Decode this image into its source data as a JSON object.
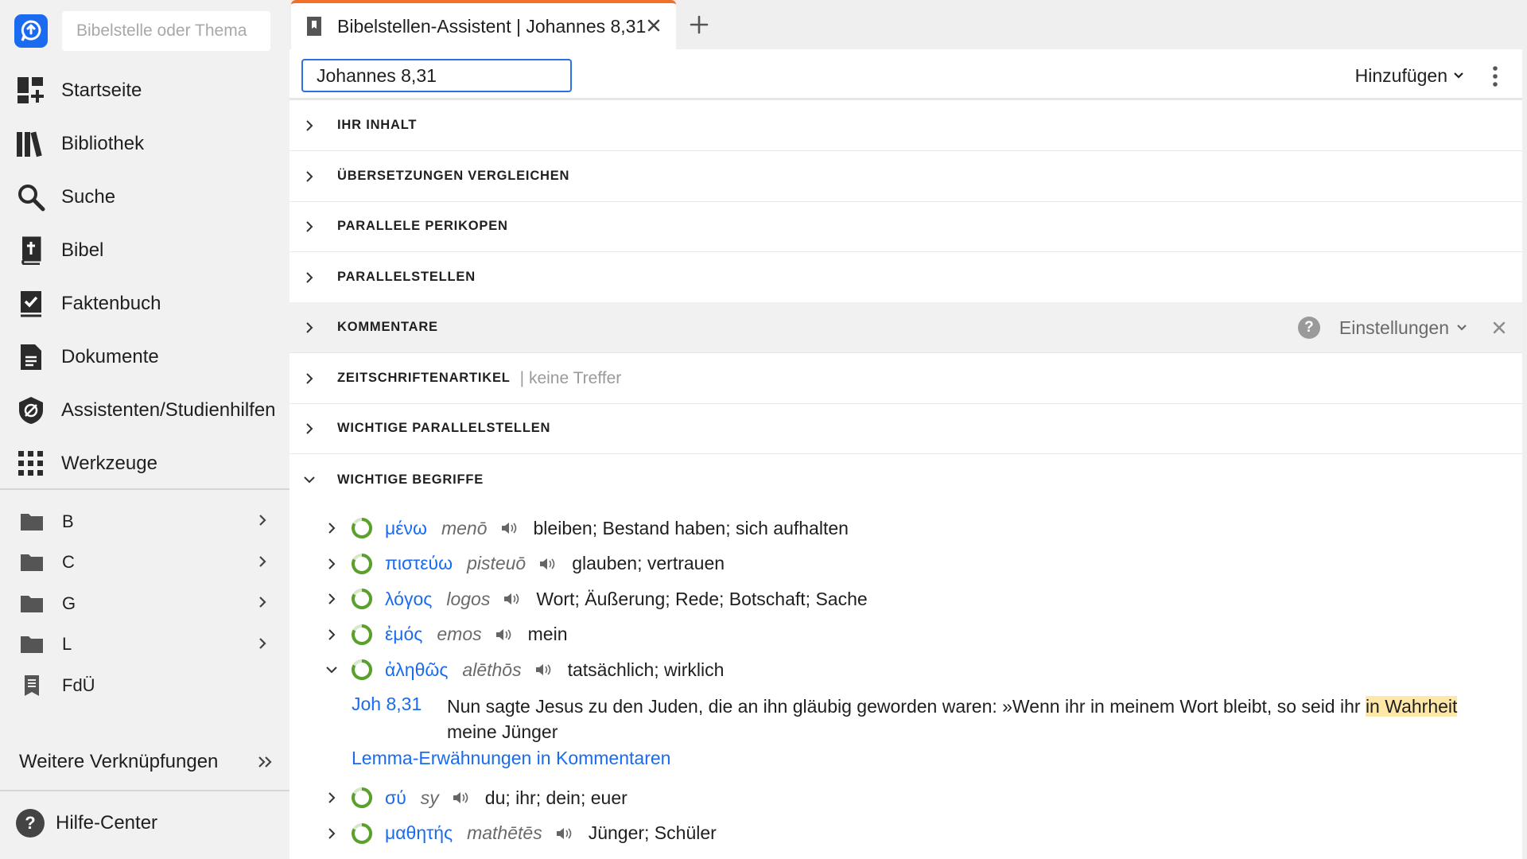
{
  "sidebar": {
    "search_placeholder": "Bibelstelle oder Thema",
    "nav": [
      {
        "label": "Startseite",
        "icon": "dashboard-icon"
      },
      {
        "label": "Bibliothek",
        "icon": "library-icon"
      },
      {
        "label": "Suche",
        "icon": "search-icon"
      },
      {
        "label": "Bibel",
        "icon": "bible-icon"
      },
      {
        "label": "Faktenbuch",
        "icon": "factbook-icon"
      },
      {
        "label": "Dokumente",
        "icon": "document-icon"
      },
      {
        "label": "Assistenten/Studienhilfen",
        "icon": "guide-icon"
      },
      {
        "label": "Werkzeuge",
        "icon": "apps-grid-icon"
      }
    ],
    "folders": [
      {
        "label": "B",
        "icon": "folder-icon"
      },
      {
        "label": "C",
        "icon": "folder-icon"
      },
      {
        "label": "G",
        "icon": "folder-icon"
      },
      {
        "label": "L",
        "icon": "folder-icon"
      },
      {
        "label": "FdÜ",
        "icon": "notebook-icon"
      }
    ],
    "more_links": "Weitere Verknüpfungen",
    "help": "Hilfe-Center"
  },
  "tab": {
    "title": "Bibelstellen-Assistent | Johannes 8,31",
    "accent": "#f0702a"
  },
  "toolbar": {
    "reference_value": "Johannes 8,31",
    "add_label": "Hinzufügen"
  },
  "sections": [
    {
      "title": "IHR INHALT"
    },
    {
      "title": "ÜBERSETZUNGEN VERGLEICHEN"
    },
    {
      "title": "PARALLELE PERIKOPEN"
    },
    {
      "title": "PARALLELSTELLEN"
    },
    {
      "title": "KOMMENTARE",
      "settings_label": "Einstellungen",
      "help_glyph": "?"
    },
    {
      "title": "ZEITSCHRIFTENARTIKEL",
      "note": "| keine Treffer"
    },
    {
      "title": "WICHTIGE PARALLELSTELLEN"
    },
    {
      "title": "WICHTIGE BEGRIFFE"
    }
  ],
  "terms": [
    {
      "greek": "μένω",
      "translit": "menō",
      "gloss": "bleiben; Bestand haben; sich aufhalten"
    },
    {
      "greek": "πιστεύω",
      "translit": "pisteuō",
      "gloss": "glauben; vertrauen"
    },
    {
      "greek": "λόγος",
      "translit": "logos",
      "gloss": "Wort; Äußerung; Rede; Botschaft; Sache"
    },
    {
      "greek": "ἐμός",
      "translit": "emos",
      "gloss": "mein"
    },
    {
      "greek": "ἀληθῶς",
      "translit": "alēthōs",
      "gloss": "tatsächlich; wirklich"
    },
    {
      "greek": "σύ",
      "translit": "sy",
      "gloss": "du; ihr; dein; euer"
    },
    {
      "greek": "μαθητής",
      "translit": "mathētēs",
      "gloss": "Jünger; Schüler"
    }
  ],
  "expanded_term": {
    "verse_ref": "Joh 8,31",
    "text_before": "Nun sagte Jesus zu den Juden, die an ihn gläubig geworden waren: »Wenn ihr in meinem Wort bleibt, so seid ihr ",
    "highlight": "in Wahrheit",
    "text_after": " meine Jünger",
    "lemma_link": "Lemma-Erwähnungen in Kommentaren"
  },
  "colors": {
    "link": "#1a6bf0",
    "ring": "#5aa02c",
    "highlight": "#fde8a8"
  }
}
